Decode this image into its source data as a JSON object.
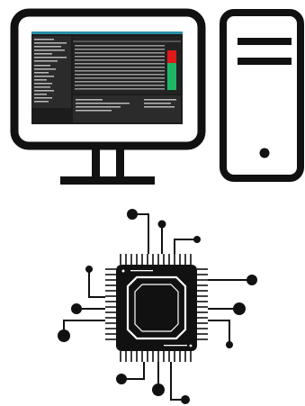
{
  "illustration": {
    "stroke_color": "#111111",
    "background_color": "#ffffff",
    "accent_green": "#1db866",
    "accent_red": "#e01818",
    "screen_title_color": "#2a8fa8",
    "icons": [
      "desktop-monitor-icon",
      "computer-tower-icon",
      "cpu-chip-icon"
    ]
  }
}
